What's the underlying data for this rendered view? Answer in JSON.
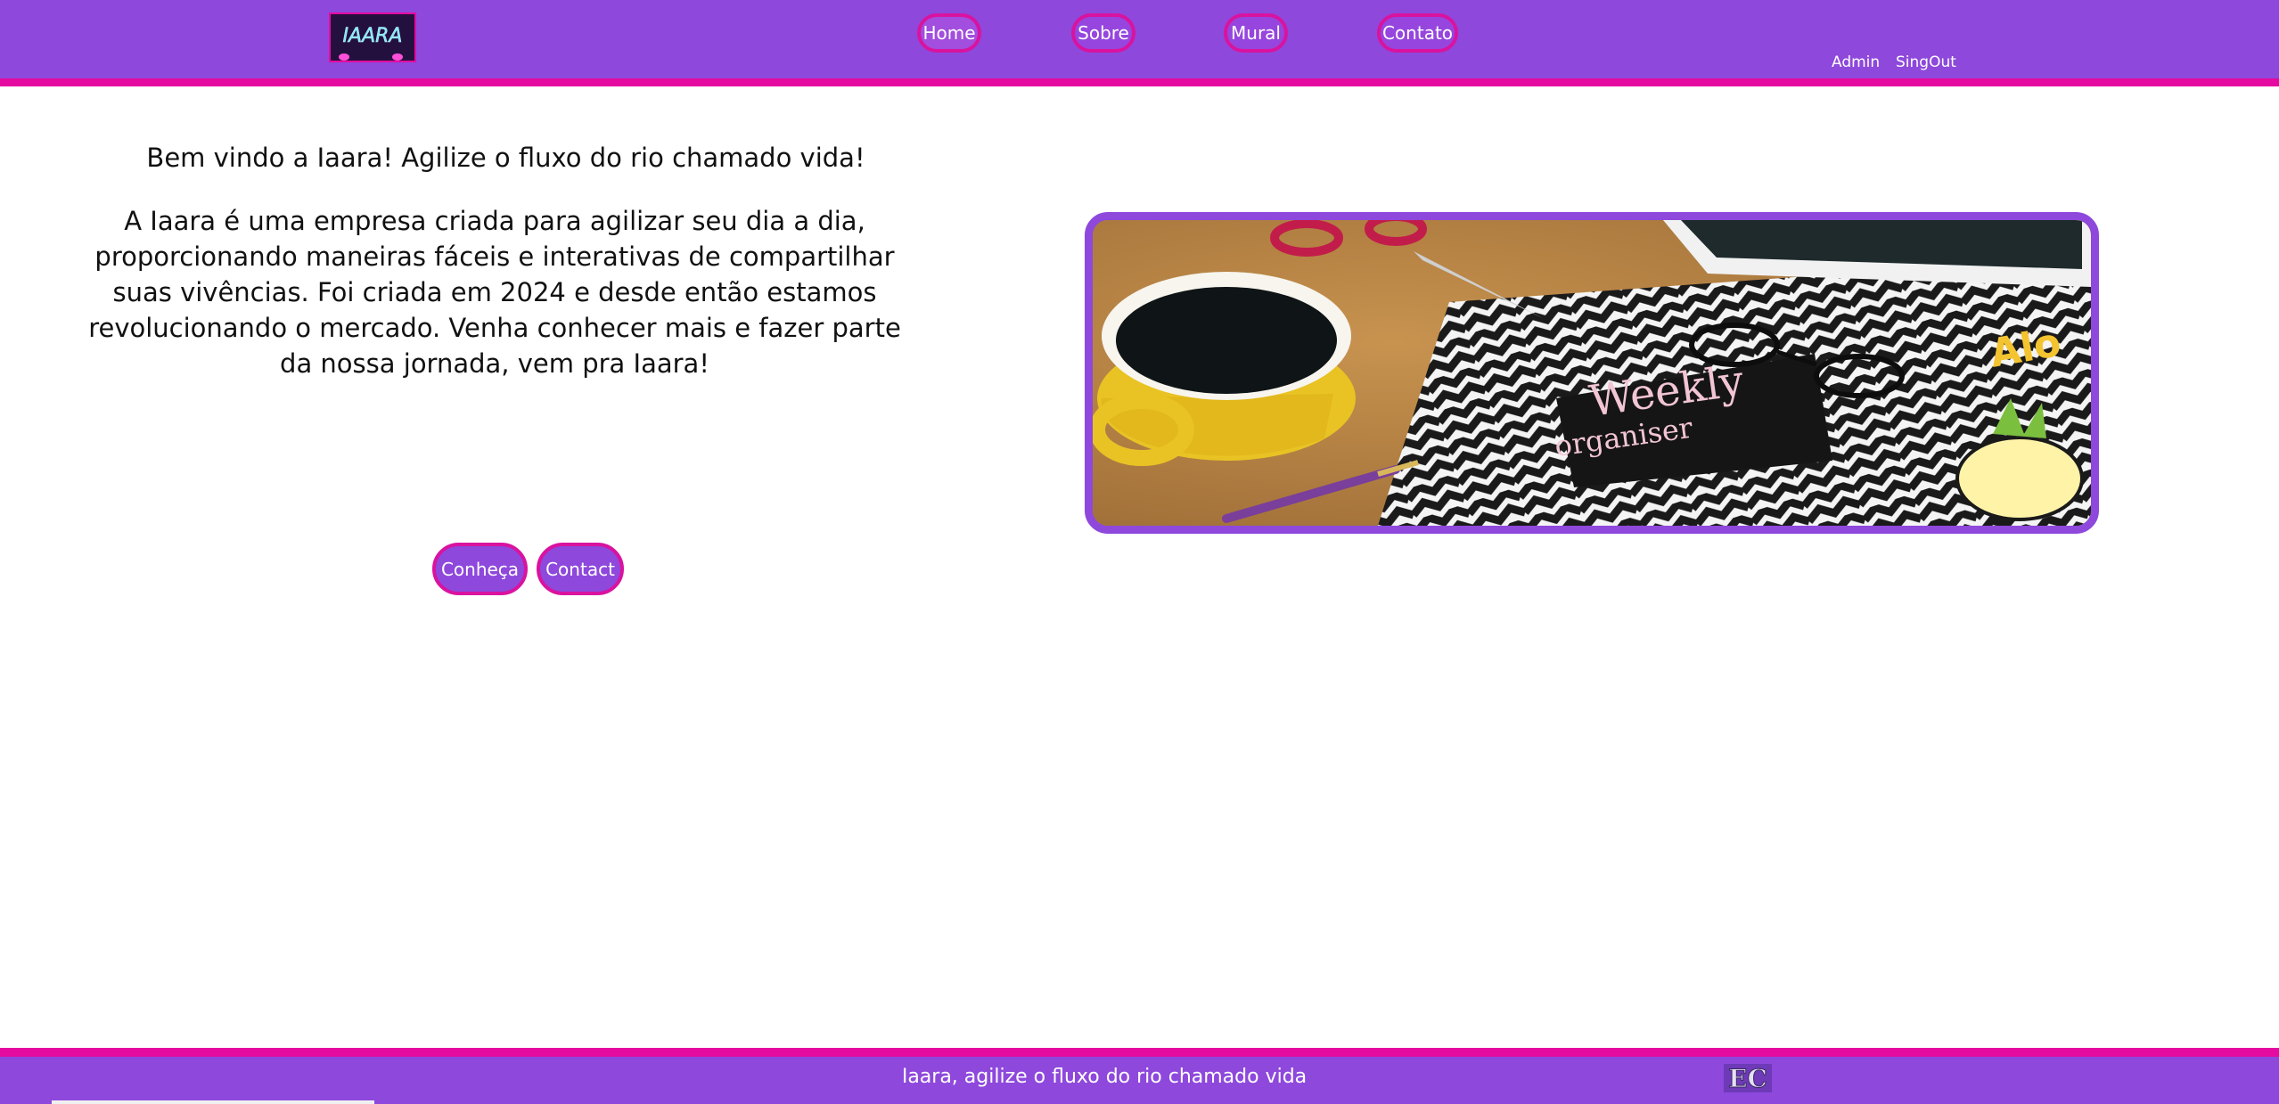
{
  "header": {
    "logo_alt": "IAARA",
    "nav": [
      "Home",
      "Sobre",
      "Mural",
      "Contato"
    ],
    "admin_label": "Admin",
    "signout_label": "SingOut"
  },
  "main": {
    "welcome": "Bem vindo a Iaara! Agilize o fluxo do rio chamado vida!",
    "intro": "A Iaara é uma empresa criada para agilizar seu dia a dia, proporcionando maneiras fáceis e interativas de compartilhar suas vivências. Foi criada em 2024 e desde então estamos revolucionando o mercado. Venha conhecer mais e fazer parte da nossa jornada, vem pra Iaara!",
    "buttons": [
      "Conheça",
      "Contact"
    ],
    "hero_image": {
      "alt": "Desk with coffee cup, scissors, phone and weekly organiser",
      "notebook_text_1": "Weekly",
      "notebook_text_2": "organiser",
      "corner_text": "Alo"
    }
  },
  "footer": {
    "tagline": "Iaara, agilize o fluxo do rio chamado vida",
    "logo_alt": "EC"
  },
  "colors": {
    "primary": "#8e48dc",
    "accent": "#e50aa0"
  }
}
